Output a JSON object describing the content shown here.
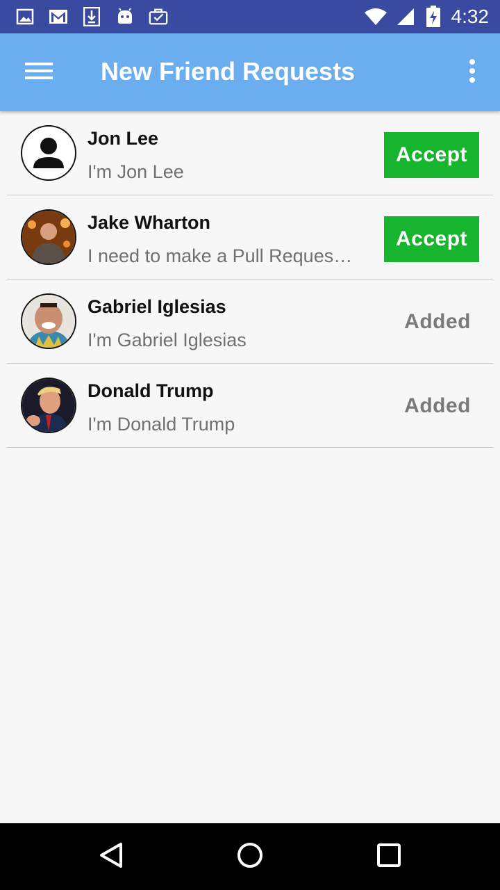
{
  "status_bar": {
    "time": "4:32",
    "left_icons": [
      "image-icon",
      "gmail-icon",
      "download-icon",
      "android-icon",
      "task-icon"
    ],
    "right_icons": [
      "wifi-icon",
      "signal-icon",
      "battery-icon"
    ]
  },
  "app_bar": {
    "title": "New Friend Requests",
    "menu_icon": "hamburger-menu-icon",
    "overflow_icon": "more-vert-icon"
  },
  "requests": [
    {
      "name": "Jon Lee",
      "message": "I'm Jon Lee",
      "action": "Accept",
      "avatar": "default-person"
    },
    {
      "name": "Jake Wharton",
      "message": "I need to make a Pull Reques…",
      "action": "Accept",
      "avatar": "photo"
    },
    {
      "name": "Gabriel Iglesias",
      "message": "I'm Gabriel Iglesias",
      "action": "Added",
      "avatar": "photo"
    },
    {
      "name": "Donald Trump",
      "message": "I'm Donald Trump",
      "action": "Added",
      "avatar": "photo"
    }
  ],
  "colors": {
    "status_bar": "#3a4aa0",
    "app_bar": "#6aaef0",
    "accept": "#17b42d",
    "added_text": "#7a7a7a"
  },
  "nav_bar": {
    "icons": [
      "back-icon",
      "home-icon",
      "recents-icon"
    ]
  }
}
